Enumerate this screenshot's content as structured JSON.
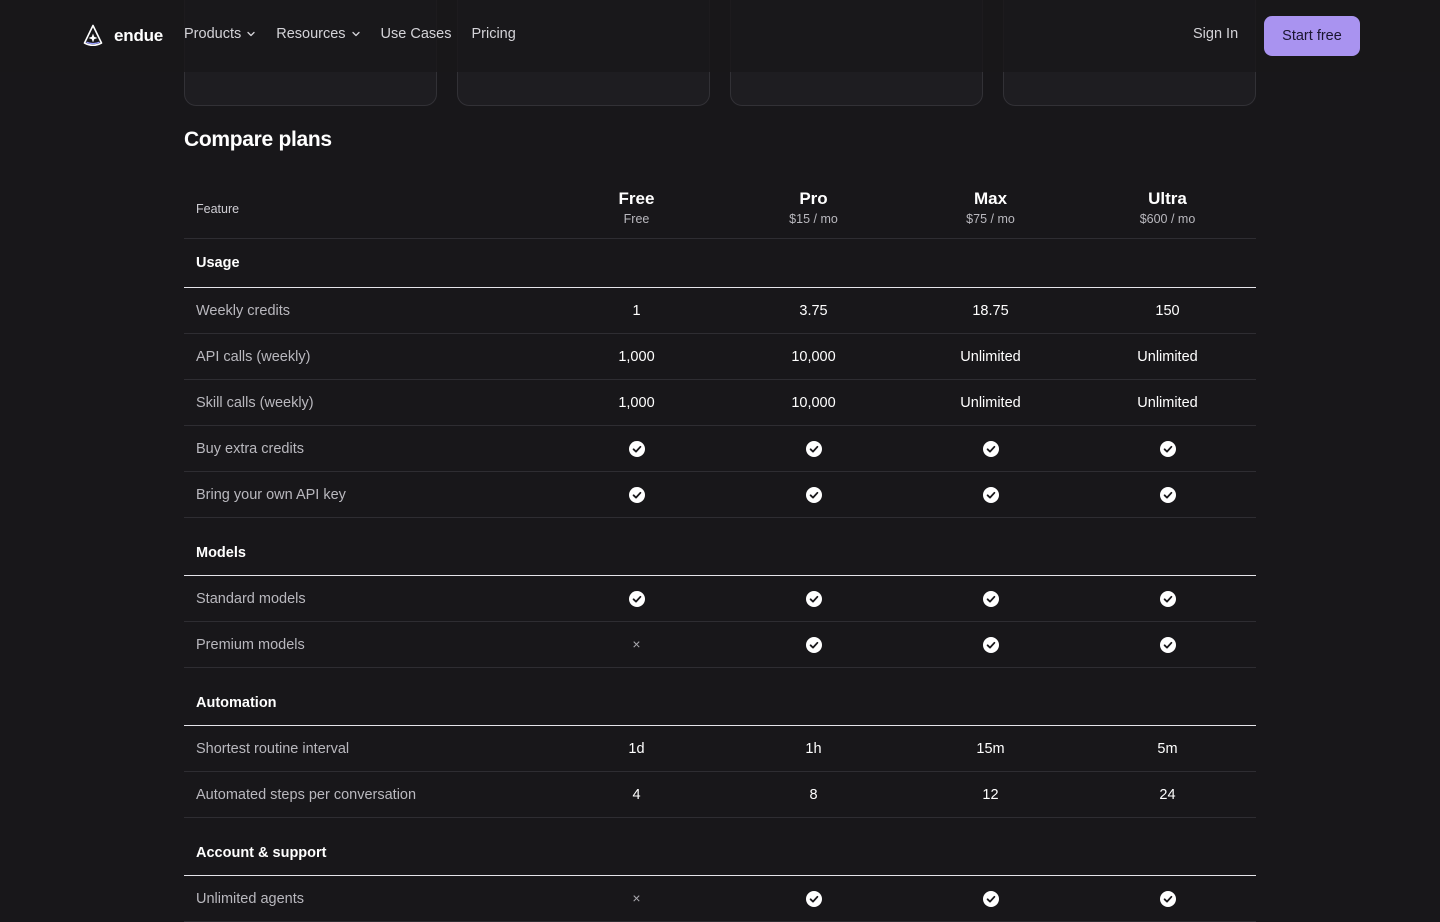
{
  "nav": {
    "brand": "endue",
    "products": "Products",
    "resources": "Resources",
    "use_cases": "Use Cases",
    "pricing": "Pricing",
    "sign_in": "Sign In",
    "start_free": "Start free"
  },
  "colors": {
    "background": "#18171a",
    "accent": "#a993f0",
    "divider": "#2e2d32"
  },
  "compare": {
    "title": "Compare plans",
    "feature_header": "Feature",
    "plans": [
      {
        "name": "Free",
        "price": "Free"
      },
      {
        "name": "Pro",
        "price": "$15 / mo"
      },
      {
        "name": "Max",
        "price": "$75 / mo"
      },
      {
        "name": "Ultra",
        "price": "$600 / mo"
      }
    ],
    "groups": [
      {
        "name": "Usage",
        "rows": [
          {
            "feature": "Weekly credits",
            "values": [
              "1",
              "3.75",
              "18.75",
              "150"
            ]
          },
          {
            "feature": "API calls (weekly)",
            "values": [
              "1,000",
              "10,000",
              "Unlimited",
              "Unlimited"
            ]
          },
          {
            "feature": "Skill calls (weekly)",
            "values": [
              "1,000",
              "10,000",
              "Unlimited",
              "Unlimited"
            ]
          },
          {
            "feature": "Buy extra credits",
            "values": [
              "check",
              "check",
              "check",
              "check"
            ]
          },
          {
            "feature": "Bring your own API key",
            "values": [
              "check",
              "check",
              "check",
              "check"
            ]
          }
        ]
      },
      {
        "name": "Models",
        "rows": [
          {
            "feature": "Standard models",
            "values": [
              "check",
              "check",
              "check",
              "check"
            ]
          },
          {
            "feature": "Premium models",
            "values": [
              "cross",
              "check",
              "check",
              "check"
            ]
          }
        ]
      },
      {
        "name": "Automation",
        "rows": [
          {
            "feature": "Shortest routine interval",
            "values": [
              "1d",
              "1h",
              "15m",
              "5m"
            ]
          },
          {
            "feature": "Automated steps per conversation",
            "values": [
              "4",
              "8",
              "12",
              "24"
            ]
          }
        ]
      },
      {
        "name": "Account & support",
        "rows": [
          {
            "feature": "Unlimited agents",
            "values": [
              "cross",
              "check",
              "check",
              "check"
            ]
          }
        ]
      }
    ],
    "icons": {
      "check": "check-circle-icon",
      "cross": "cross-icon",
      "cross_glyph": "×"
    }
  }
}
